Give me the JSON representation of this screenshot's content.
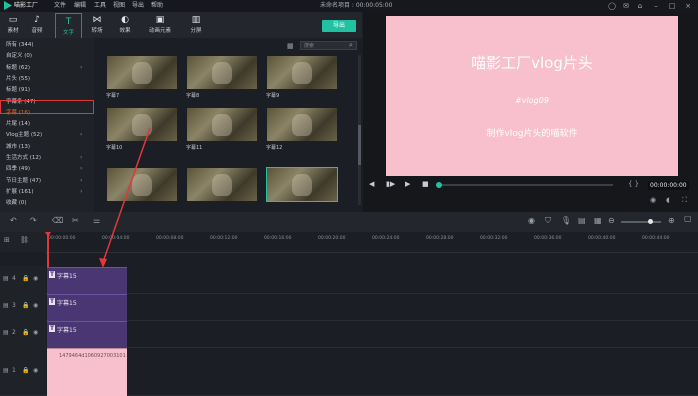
{
  "app": {
    "brand": "喵影工厂",
    "timecode_title": "未命名项目 : 00:00:05:00"
  },
  "menu": [
    "文件",
    "编辑",
    "工具",
    "视图",
    "导出",
    "帮助"
  ],
  "toolbar": {
    "items": [
      {
        "label": "素材",
        "icon": "folder-icon"
      },
      {
        "label": "音频",
        "icon": "music-icon"
      },
      {
        "label": "文字",
        "icon": "text-icon"
      },
      {
        "label": "转场",
        "icon": "transition-icon"
      },
      {
        "label": "效果",
        "icon": "effects-icon"
      },
      {
        "label": "动画元素",
        "icon": "elements-icon"
      },
      {
        "label": "分屏",
        "icon": "split-icon"
      }
    ],
    "export_label": "导出"
  },
  "sidebar": {
    "categories": [
      {
        "label": "所有 (344)",
        "chevron": false
      },
      {
        "label": "自定义 (0)",
        "chevron": false
      },
      {
        "label": "标题 (62)",
        "chevron": true
      },
      {
        "label": "片头 (55)",
        "chevron": false
      },
      {
        "label": "标题 (91)",
        "chevron": false
      },
      {
        "label": "字幕条 (47)",
        "chevron": false
      },
      {
        "label": "字幕 (16)",
        "chevron": false,
        "active": true
      },
      {
        "label": "片尾 (14)",
        "chevron": false
      },
      {
        "label": "Vlog主题 (52)",
        "chevron": true
      },
      {
        "label": "城市 (13)",
        "chevron": false
      },
      {
        "label": "生活方式 (12)",
        "chevron": true
      },
      {
        "label": "四季 (49)",
        "chevron": true
      },
      {
        "label": "节日主题 (47)",
        "chevron": true
      },
      {
        "label": "扩展 (161)",
        "chevron": true
      },
      {
        "label": "收藏 (0)",
        "chevron": false
      }
    ]
  },
  "grid": {
    "search_placeholder": "搜索",
    "items": [
      "字幕7",
      "字幕8",
      "字幕9",
      "字幕10",
      "字幕11",
      "字幕12",
      "字幕13",
      "字幕14",
      "字幕15"
    ]
  },
  "preview": {
    "title": "喵影工厂vlog片头",
    "tag": "#vlog09",
    "subtitle": "制作vlog片头的喵软件",
    "timecode": "00:00:00:00",
    "bg_color": "#f7c0cc"
  },
  "timeline": {
    "ruler": [
      "00:00:00:00",
      "00:00:04:00",
      "00:00:08:00",
      "00:00:12:00",
      "00:00:16:00",
      "00:00:20:00",
      "00:00:24:00",
      "00:00:28:00",
      "00:00:32:00",
      "00:00:36:00",
      "00:00:40:00",
      "00:00:44:00"
    ],
    "tracks": [
      {
        "num": "4",
        "clip": "字幕15"
      },
      {
        "num": "3",
        "clip": "字幕15"
      },
      {
        "num": "2",
        "clip": "字幕15"
      },
      {
        "num": "1",
        "clip": "1479464d1060927003101"
      }
    ]
  }
}
